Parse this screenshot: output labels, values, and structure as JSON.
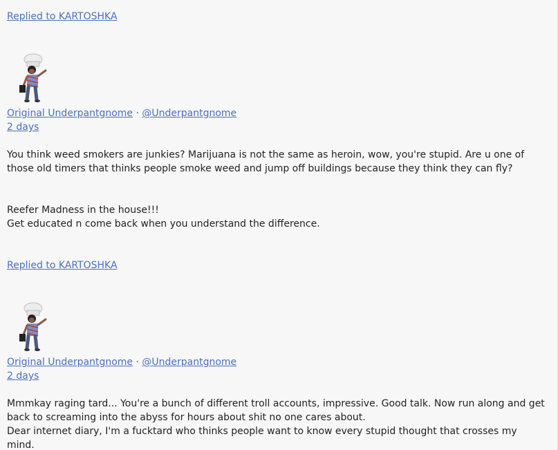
{
  "posts": [
    {
      "reply_label": "Replied to KARTOSHKA",
      "author_name": "Original Underpantgnome",
      "separator": "·",
      "author_handle": "@Underpantgnome",
      "time_ago": "2 days",
      "paragraphs": [
        "You think weed smokers are junkies? Marijuana is not the same as heroin, wow, you're stupid. Are u one of those old timers that thinks people smoke weed and jump off buildings because they think they can fly?",
        "Reefer Madness in the house!!!",
        "Get educated n come back when you understand the difference."
      ]
    },
    {
      "reply_label": "Replied to KARTOSHKA",
      "author_name": "Original Underpantgnome",
      "separator": "·",
      "author_handle": "@Underpantgnome",
      "time_ago": "2 days",
      "paragraphs": [
        "Mmmkay raging tard... You're a bunch of different troll accounts, impressive. Good talk. Now run along and get back to screaming into the abyss for hours about shit no one cares about.",
        "Dear internet diary, I'm a fucktard who thinks people want to know every stupid thought that crosses my mind."
      ]
    }
  ],
  "colors": {
    "link": "#4a6fc0",
    "text": "#222222",
    "background": "#f7f7f7"
  }
}
